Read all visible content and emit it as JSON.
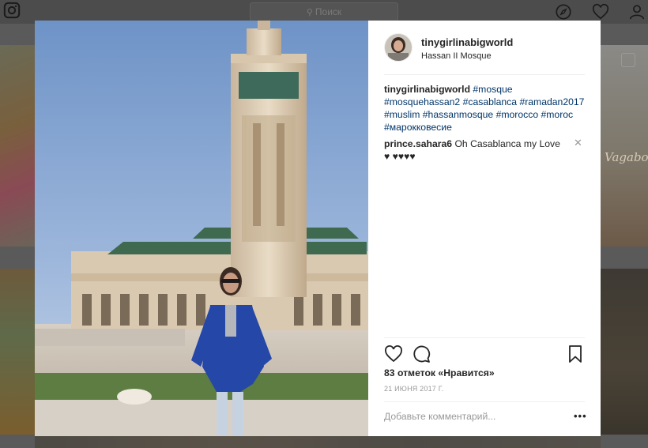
{
  "topbar": {
    "search_placeholder": "Поиск",
    "icons": [
      "instagram-logo-icon",
      "explore-icon",
      "heart-icon",
      "profile-icon"
    ]
  },
  "background": {
    "tile_text": "Vagabo"
  },
  "post": {
    "header": {
      "username": "tinygirlinabigworld",
      "location": "Hassan II Mosque"
    },
    "caption": {
      "username": "tinygirlinabigworld",
      "hashtags": [
        "#mosque",
        "#mosquehassan2",
        "#casablanca",
        "#ramadan2017",
        "#muslim",
        "#hassanmosque",
        "#morocco",
        "#moroc",
        "#марокковесие"
      ]
    },
    "comments": [
      {
        "username": "prince.sahara6",
        "text": "Oh Casablanca my Love ♥ ♥♥♥♥"
      }
    ],
    "likes_text": "83 отметок «Нравится»",
    "date": "21 ИЮНЯ 2017 Г.",
    "add_comment_placeholder": "Добавьте комментарий...",
    "more_label": "•••",
    "icons": [
      "like-heart-icon",
      "comment-icon",
      "bookmark-icon"
    ]
  },
  "colors": {
    "hashtag": "#003569",
    "text": "#262626",
    "muted": "#999999",
    "overlay": "#5a5a5a"
  }
}
